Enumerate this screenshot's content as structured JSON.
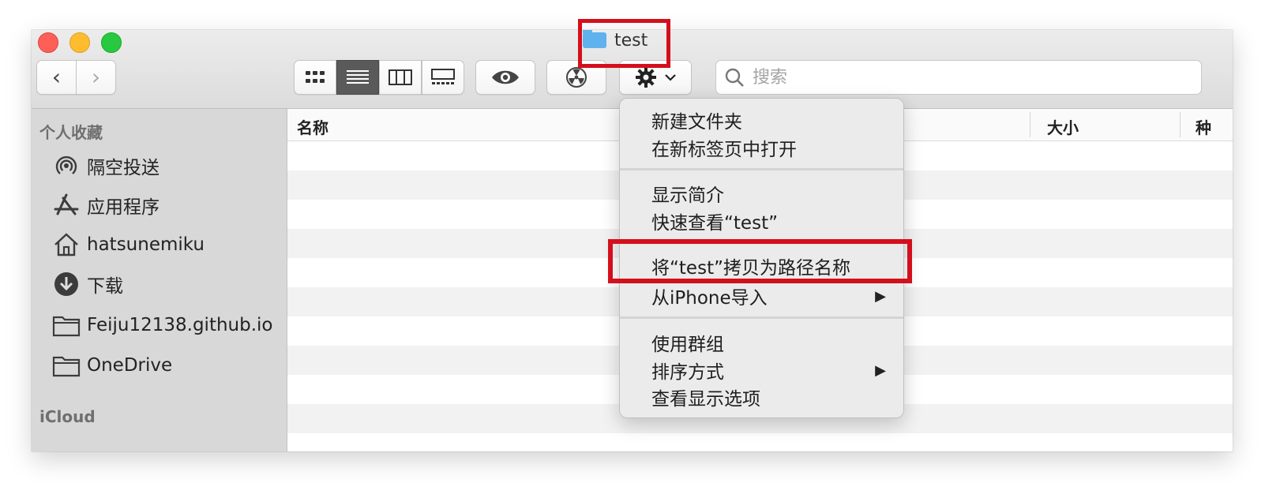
{
  "window": {
    "title": "test"
  },
  "toolbar": {
    "search_placeholder": "搜索"
  },
  "sidebar": {
    "favorites_header": "个人收藏",
    "items": [
      {
        "label": "隔空投送",
        "icon": "airdrop-icon"
      },
      {
        "label": "应用程序",
        "icon": "applications-icon"
      },
      {
        "label": "hatsunemiku",
        "icon": "home-icon"
      },
      {
        "label": "下载",
        "icon": "download-icon"
      },
      {
        "label": "Feiju12138.github.io",
        "icon": "folder-icon"
      },
      {
        "label": "OneDrive",
        "icon": "folder-icon"
      }
    ],
    "icloud_header": "iCloud"
  },
  "columns": {
    "name": "名称",
    "size": "大小",
    "kind": "种"
  },
  "context_menu": {
    "group1": [
      "新建文件夹",
      "在新标签页中打开"
    ],
    "group2": [
      "显示简介",
      "快速查看“test”"
    ],
    "group3": [
      "将“test”拷贝为路径名称",
      "从iPhone导入"
    ],
    "group4": [
      "使用群组",
      "排序方式",
      "查看显示选项"
    ],
    "submenu_arrow": "▶"
  },
  "colors": {
    "highlight": "#d40f1c",
    "folder": "#5fb2ee"
  }
}
